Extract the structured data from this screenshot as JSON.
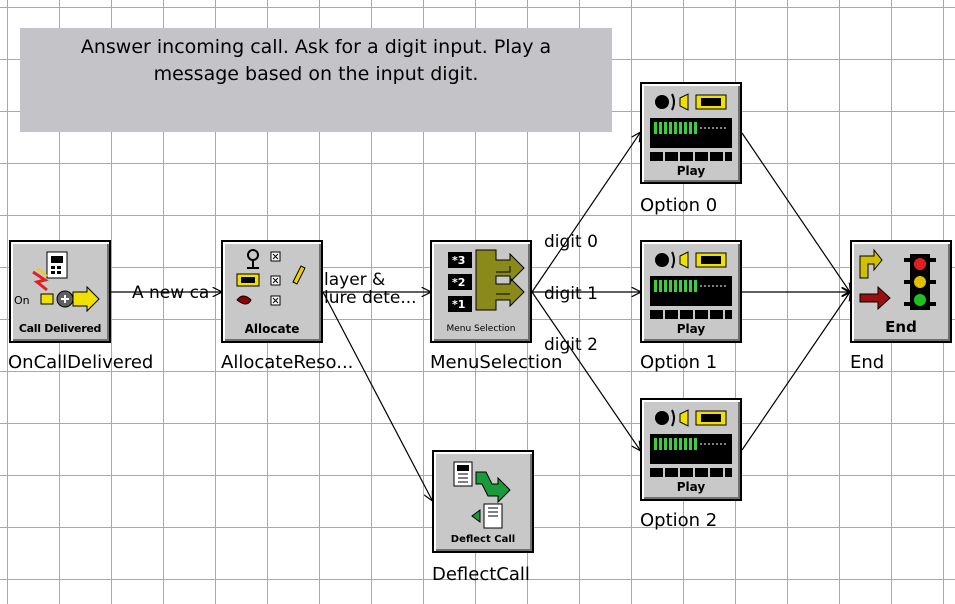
{
  "comment": {
    "line1": "Answer incoming call. Ask for a digit input. Play a",
    "line2": "message based on the input digit."
  },
  "nodes": {
    "on_call_delivered": {
      "caption_top": "On",
      "caption": "Call Delivered",
      "name": "OnCallDelivered"
    },
    "allocate": {
      "caption": "Allocate",
      "name": "AllocateReso..."
    },
    "menu_selection": {
      "caption": "Menu Selection",
      "name": "MenuSelection",
      "keys": [
        "*3",
        "*2",
        "*1"
      ]
    },
    "deflect_call": {
      "caption": "Deflect Call",
      "name": "DeflectCall"
    },
    "option0": {
      "caption": "Play",
      "name": "Option 0"
    },
    "option1": {
      "caption": "Play",
      "name": "Option 1"
    },
    "option2": {
      "caption": "Play",
      "name": "Option 2"
    },
    "end": {
      "caption": "End",
      "name": "End"
    }
  },
  "edges": {
    "call_to_allocate": "A new ca",
    "allocate_to_menu_a": "layer &",
    "allocate_to_menu_b": "lure dete...",
    "digit0": "digit 0",
    "digit1": "digit 1",
    "digit2": "digit 2"
  },
  "colors": {
    "comment_bg": "#c4c4c8",
    "node_bg": "#c8c8c8",
    "menu_arrow": "#8a8a1a",
    "deflect_arrow": "#1a9a3a",
    "end_arrow_red": "#9a1010",
    "end_arrow_yellow": "#d0c000",
    "display_bg": "#000000",
    "display_bar": "#3ad03a"
  }
}
